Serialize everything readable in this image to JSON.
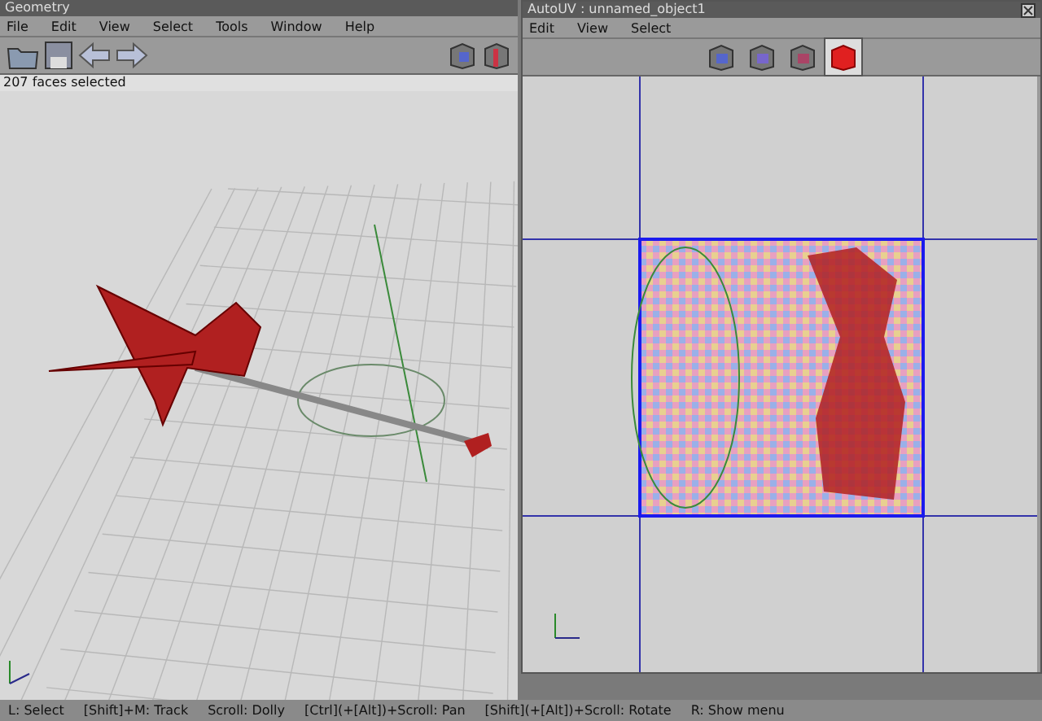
{
  "geometry_window": {
    "title": "Geometry",
    "menu": [
      "File",
      "Edit",
      "View",
      "Select",
      "Tools",
      "Window",
      "Help"
    ],
    "status": "207 faces selected"
  },
  "autouv_window": {
    "title": "AutoUV : unnamed_object1",
    "menu": [
      "Edit",
      "View",
      "Select"
    ],
    "modes": [
      {
        "kind": "vertex",
        "selected": false
      },
      {
        "kind": "edge",
        "selected": false
      },
      {
        "kind": "face",
        "selected": false
      },
      {
        "kind": "body",
        "selected": true
      }
    ]
  },
  "status_bar": [
    "L: Select",
    "[Shift]+M: Track",
    "Scroll: Dolly",
    "[Ctrl](+[Alt])+Scroll: Pan",
    "[Shift](+[Alt])+Scroll: Rotate",
    "R: Show menu"
  ]
}
